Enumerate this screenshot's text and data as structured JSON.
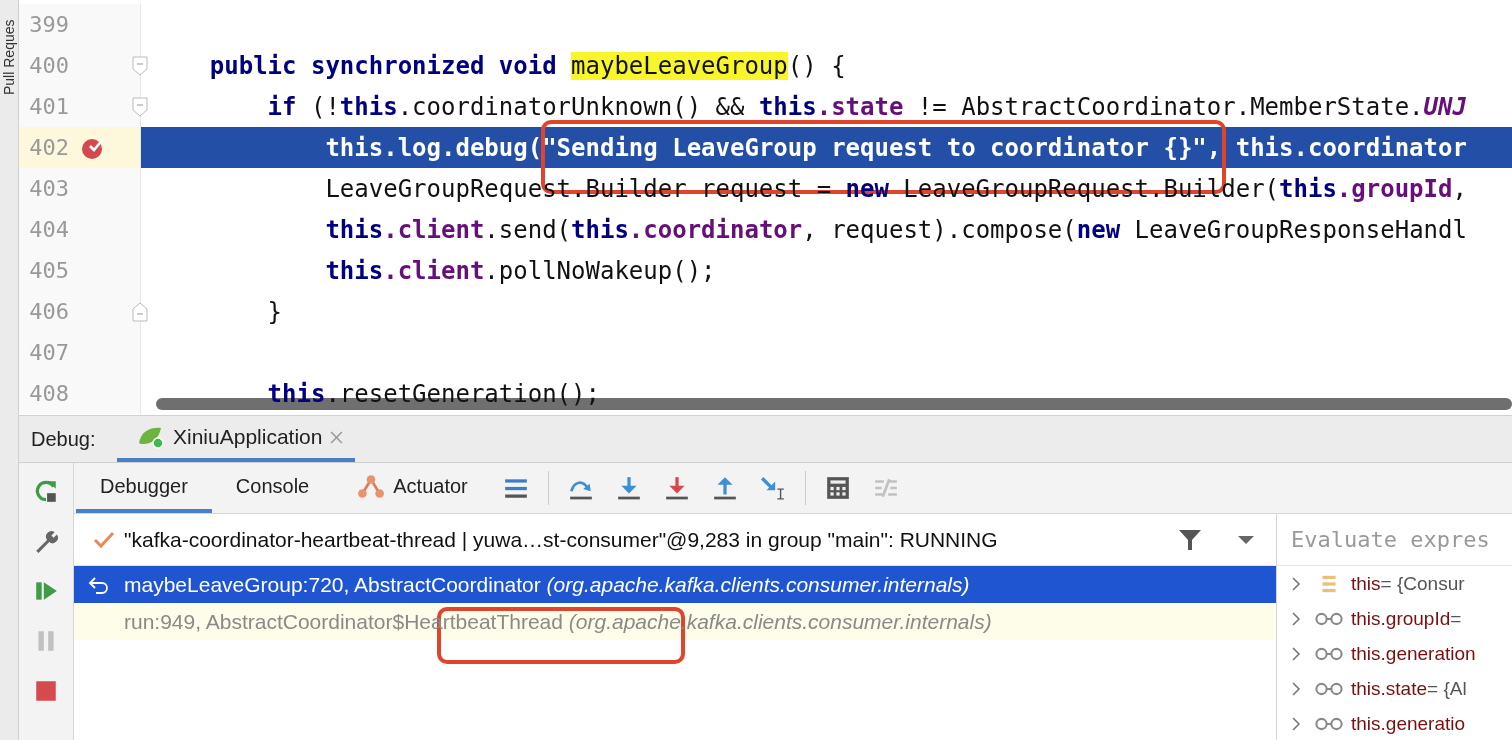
{
  "side_strip": {
    "label": "Pull Reques"
  },
  "editor": {
    "lines": [
      {
        "number": "399",
        "current": false
      },
      {
        "number": "400",
        "current": false,
        "fold_start": true,
        "tokens": [
          {
            "kind": "kw",
            "text": "    public synchronized void "
          },
          {
            "kind": "match",
            "text": "maybeLeaveGroup"
          },
          {
            "kind": "plain",
            "text": "() {"
          }
        ]
      },
      {
        "number": "401",
        "current": false,
        "fold_start": true,
        "tokens": [
          {
            "kind": "kw",
            "text": "        if"
          },
          {
            "kind": "plain",
            "text": " (!"
          },
          {
            "kind": "kw",
            "text": "this"
          },
          {
            "kind": "plain",
            "text": ".coordinatorUnknown() && "
          },
          {
            "kind": "kw",
            "text": "this"
          },
          {
            "kind": "field",
            "text": ".state"
          },
          {
            "kind": "plain",
            "text": " != AbstractCoordinator.MemberState."
          },
          {
            "kind": "const",
            "text": "UNJ"
          }
        ]
      },
      {
        "number": "402",
        "current": true,
        "breakpoint": true,
        "tokens": [
          {
            "kind": "kw",
            "text": "            this"
          },
          {
            "kind": "plain",
            "text": ".log.debug("
          },
          {
            "kind": "str",
            "text": "\"Sending LeaveGroup request to coordinator {}\""
          },
          {
            "kind": "plain",
            "text": ", "
          },
          {
            "kind": "kw",
            "text": "this"
          },
          {
            "kind": "field",
            "text": ".coordinator"
          }
        ]
      },
      {
        "number": "403",
        "current": false,
        "tokens": [
          {
            "kind": "plain",
            "text": "            LeaveGroupRequest.Builder request = "
          },
          {
            "kind": "kw",
            "text": "new"
          },
          {
            "kind": "plain",
            "text": " LeaveGroupRequest.Builder("
          },
          {
            "kind": "kw",
            "text": "this"
          },
          {
            "kind": "field",
            "text": ".groupId"
          },
          {
            "kind": "plain",
            "text": ","
          }
        ]
      },
      {
        "number": "404",
        "current": false,
        "tokens": [
          {
            "kind": "kw",
            "text": "            this"
          },
          {
            "kind": "field",
            "text": ".client"
          },
          {
            "kind": "plain",
            "text": ".send("
          },
          {
            "kind": "kw",
            "text": "this"
          },
          {
            "kind": "field",
            "text": ".coordinator"
          },
          {
            "kind": "plain",
            "text": ", request).compose("
          },
          {
            "kind": "kw",
            "text": "new"
          },
          {
            "kind": "plain",
            "text": " LeaveGroupResponseHandl"
          }
        ]
      },
      {
        "number": "405",
        "current": false,
        "tokens": [
          {
            "kind": "kw",
            "text": "            this"
          },
          {
            "kind": "field",
            "text": ".client"
          },
          {
            "kind": "plain",
            "text": ".pollNoWakeup();"
          }
        ]
      },
      {
        "number": "406",
        "current": false,
        "fold_end": true,
        "tokens": [
          {
            "kind": "plain",
            "text": "        }"
          }
        ]
      },
      {
        "number": "407",
        "current": false
      },
      {
        "number": "408",
        "current": false,
        "tokens": [
          {
            "kind": "kw",
            "text": "        this"
          },
          {
            "kind": "plain",
            "text": ".resetGeneration();"
          }
        ]
      }
    ]
  },
  "debug": {
    "label": "Debug:",
    "session_tab": {
      "label": "XiniuApplication",
      "selected": true
    },
    "side_tools": [
      {
        "kind": "rerun",
        "disabled": false
      },
      {
        "kind": "settings",
        "disabled": false
      },
      {
        "kind": "resume",
        "disabled": false
      },
      {
        "kind": "pause",
        "disabled": true
      },
      {
        "kind": "stop",
        "disabled": false
      }
    ],
    "tabs": [
      {
        "label": "Debugger",
        "kind": "plain",
        "selected": true
      },
      {
        "label": "Console",
        "kind": "plain",
        "selected": false
      },
      {
        "label": "Actuator",
        "kind": "actuator",
        "selected": false
      }
    ],
    "actions": [
      {
        "kind": "layout",
        "disabled": false
      },
      {
        "kind": "step-over",
        "disabled": false
      },
      {
        "kind": "step-into",
        "disabled": false
      },
      {
        "kind": "force-step-into",
        "disabled": false
      },
      {
        "kind": "step-out",
        "disabled": false
      },
      {
        "kind": "run-to-cursor",
        "disabled": false
      },
      {
        "kind": "evaluate",
        "disabled": false
      },
      {
        "kind": "trace",
        "disabled": true
      }
    ],
    "thread": {
      "label": "\"kafka-coordinator-heartbeat-thread | yuwa…st-consumer\"@9,283 in group \"main\": RUNNING"
    },
    "frames": [
      {
        "method": "maybeLeaveGroup:720, AbstractCoordinator",
        "package": "(org.apache.kafka.clients.consumer.internals)",
        "selected": true
      },
      {
        "method": "run:949, AbstractCoordinator$HeartbeatThread",
        "package": "(org.apache.kafka.clients.consumer.internals)",
        "selected": false
      }
    ],
    "evaluate": {
      "placeholder": "Evaluate expres"
    },
    "variables": [
      {
        "kind": "object",
        "name": "this",
        "value": "= {Consur"
      },
      {
        "kind": "watch",
        "name": "this.groupId",
        "value": "="
      },
      {
        "kind": "watch",
        "name": "this.generation"
      },
      {
        "kind": "watch",
        "name": "this.state",
        "value": "= {Al"
      },
      {
        "kind": "watch",
        "name": "this.generatio"
      }
    ]
  }
}
